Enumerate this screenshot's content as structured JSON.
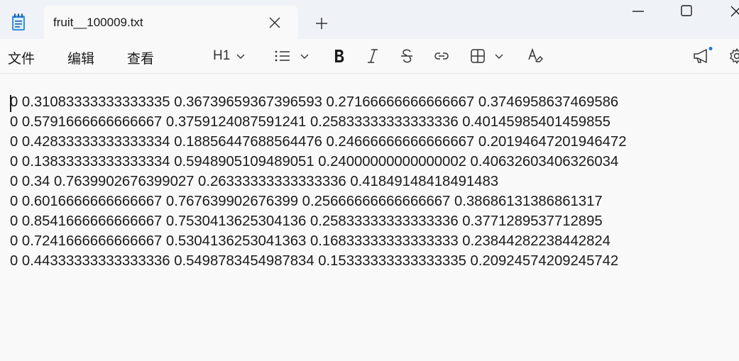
{
  "window": {
    "tab_title": "fruit__100009.txt",
    "new_tab_symbol": "+"
  },
  "menu": {
    "file": "文件",
    "edit": "编辑",
    "view": "查看"
  },
  "toolbar": {
    "heading_label": "H1"
  },
  "document": {
    "lines": [
      "0 0.31083333333333335 0.36739659367396593 0.27166666666666667 0.3746958637469586",
      "0 0.5791666666666667 0.3759124087591241 0.25833333333333336 0.40145985401459855",
      "0 0.42833333333333334 0.18856447688564476 0.24666666666666667 0.20194647201946472",
      "0 0.13833333333333334 0.5948905109489051 0.24000000000000002 0.40632603406326034",
      "0 0.34 0.7639902676399027 0.26333333333333336 0.41849148418491483",
      "0 0.6016666666666667 0.767639902676399 0.25666666666666667 0.38686131386861317",
      "0 0.8541666666666667 0.7530413625304136 0.25833333333333336 0.3771289537712895",
      "0 0.7241666666666667 0.5304136253041363 0.16833333333333333 0.23844282238442824",
      "0 0.44333333333333336 0.5498783454987834 0.15333333333333335 0.20924574209245742"
    ]
  },
  "colors": {
    "titlebar_bg": "#eff3f7",
    "editor_bg": "#f9f9f9",
    "text": "#1b1b1b",
    "app_icon_blue": "#2b7fd6",
    "notification_dot": "#1a73e8"
  }
}
